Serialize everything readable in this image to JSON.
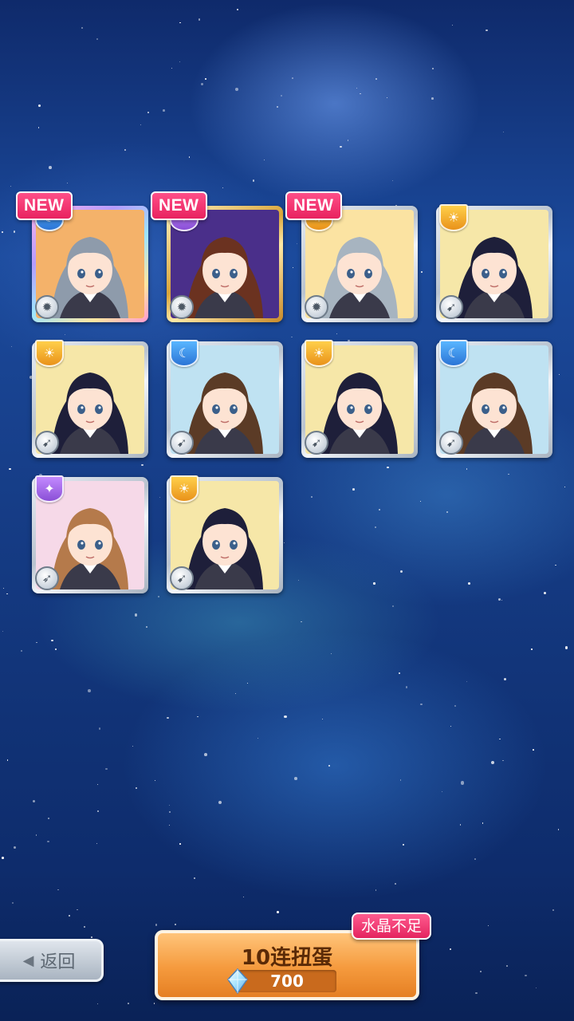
{
  "result_cards": [
    {
      "new_badge": "NEW",
      "attribute_icon": "moon-icon",
      "attribute_glyph": "☾",
      "weapon_icon": "gear-weapon-icon",
      "weapon_glyph": "✹",
      "frame": "rainbow",
      "hair": "#8e9bab",
      "bg": "#f4b26a"
    },
    {
      "new_badge": "NEW",
      "attribute_icon": "star-icon",
      "attribute_glyph": "✦",
      "weapon_icon": "gear-weapon-icon",
      "weapon_glyph": "✹",
      "frame": "gold",
      "hair": "#6b3220",
      "bg": "#4a2f8a"
    },
    {
      "new_badge": "NEW",
      "attribute_icon": "sun-icon",
      "attribute_glyph": "☀",
      "weapon_icon": "gear-weapon-icon",
      "weapon_glyph": "✹",
      "frame": "silver",
      "hair": "#a7b4c0",
      "bg": "#fbe3a2"
    },
    {
      "new_badge": "",
      "attribute_icon": "sun-icon",
      "attribute_glyph": "☀",
      "weapon_icon": "gun-weapon-icon",
      "weapon_glyph": "➹",
      "frame": "silver",
      "hair": "#1e1f3a",
      "bg": "#f6e7a8"
    },
    {
      "new_badge": "",
      "attribute_icon": "sun-icon",
      "attribute_glyph": "☀",
      "weapon_icon": "gun-weapon-icon",
      "weapon_glyph": "➹",
      "frame": "silver",
      "hair": "#1e1f3a",
      "bg": "#f6e7a8"
    },
    {
      "new_badge": "",
      "attribute_icon": "moon-icon",
      "attribute_glyph": "☾",
      "weapon_icon": "gun-weapon-icon",
      "weapon_glyph": "➹",
      "frame": "silver",
      "hair": "#5b3b26",
      "bg": "#bfe2f2"
    },
    {
      "new_badge": "",
      "attribute_icon": "sun-icon",
      "attribute_glyph": "☀",
      "weapon_icon": "gun-weapon-icon",
      "weapon_glyph": "➹",
      "frame": "silver",
      "hair": "#1e1f3a",
      "bg": "#f6e7a8"
    },
    {
      "new_badge": "",
      "attribute_icon": "moon-icon",
      "attribute_glyph": "☾",
      "weapon_icon": "gun-weapon-icon",
      "weapon_glyph": "➹",
      "frame": "silver",
      "hair": "#5b3b26",
      "bg": "#bfe2f2"
    },
    {
      "new_badge": "",
      "attribute_icon": "star-icon",
      "attribute_glyph": "✦",
      "weapon_icon": "knife-weapon-icon",
      "weapon_glyph": "➶",
      "frame": "silver",
      "hair": "#b57a4b",
      "bg": "#f6d9e8"
    },
    {
      "new_badge": "",
      "attribute_icon": "sun-icon",
      "attribute_glyph": "☀",
      "weapon_icon": "gun-weapon-icon",
      "weapon_glyph": "➹",
      "frame": "silver",
      "hair": "#1e1f3a",
      "bg": "#f6e7a8"
    }
  ],
  "back_button": {
    "label": "返回",
    "arrow": "◀"
  },
  "gacha_button": {
    "label": "10连扭蛋",
    "cost": "700",
    "currency_icon": "crystal-icon"
  },
  "warning_badge": {
    "label": "水晶不足"
  }
}
